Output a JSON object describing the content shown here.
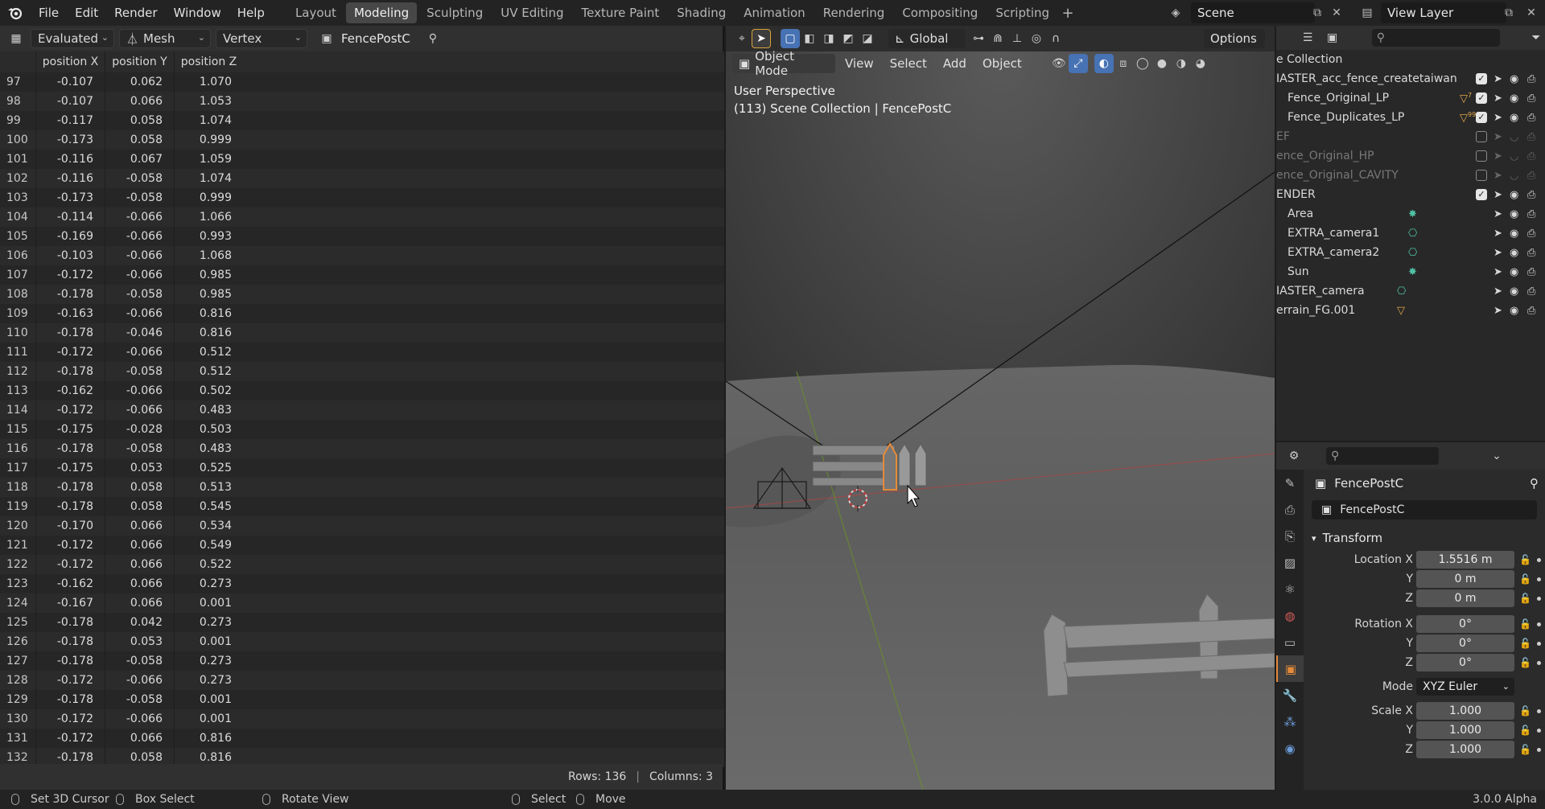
{
  "menu": [
    "File",
    "Edit",
    "Render",
    "Window",
    "Help"
  ],
  "workspaces": [
    "Layout",
    "Modeling",
    "Sculpting",
    "UV Editing",
    "Texture Paint",
    "Shading",
    "Animation",
    "Rendering",
    "Compositing",
    "Scripting"
  ],
  "active_workspace": "Modeling",
  "scene_name": "Scene",
  "view_layer_name": "View Layer",
  "spreadsheet": {
    "evaluation": "Evaluated",
    "geometry": "Mesh",
    "domain": "Vertex",
    "object": "FencePostC",
    "columns": [
      "position X",
      "position Y",
      "position Z"
    ],
    "rows": [
      [
        "97",
        "-0.107",
        "0.062",
        "1.070"
      ],
      [
        "98",
        "-0.107",
        "0.066",
        "1.053"
      ],
      [
        "99",
        "-0.117",
        "0.058",
        "1.074"
      ],
      [
        "100",
        "-0.173",
        "0.058",
        "0.999"
      ],
      [
        "101",
        "-0.116",
        "0.067",
        "1.059"
      ],
      [
        "102",
        "-0.116",
        "-0.058",
        "1.074"
      ],
      [
        "103",
        "-0.173",
        "-0.058",
        "0.999"
      ],
      [
        "104",
        "-0.114",
        "-0.066",
        "1.066"
      ],
      [
        "105",
        "-0.169",
        "-0.066",
        "0.993"
      ],
      [
        "106",
        "-0.103",
        "-0.066",
        "1.068"
      ],
      [
        "107",
        "-0.172",
        "-0.066",
        "0.985"
      ],
      [
        "108",
        "-0.178",
        "-0.058",
        "0.985"
      ],
      [
        "109",
        "-0.163",
        "-0.066",
        "0.816"
      ],
      [
        "110",
        "-0.178",
        "-0.046",
        "0.816"
      ],
      [
        "111",
        "-0.172",
        "-0.066",
        "0.512"
      ],
      [
        "112",
        "-0.178",
        "-0.058",
        "0.512"
      ],
      [
        "113",
        "-0.162",
        "-0.066",
        "0.502"
      ],
      [
        "114",
        "-0.172",
        "-0.066",
        "0.483"
      ],
      [
        "115",
        "-0.175",
        "-0.028",
        "0.503"
      ],
      [
        "116",
        "-0.178",
        "-0.058",
        "0.483"
      ],
      [
        "117",
        "-0.175",
        "0.053",
        "0.525"
      ],
      [
        "118",
        "-0.178",
        "0.058",
        "0.513"
      ],
      [
        "119",
        "-0.178",
        "0.058",
        "0.545"
      ],
      [
        "120",
        "-0.170",
        "0.066",
        "0.534"
      ],
      [
        "121",
        "-0.172",
        "0.066",
        "0.549"
      ],
      [
        "122",
        "-0.172",
        "0.066",
        "0.522"
      ],
      [
        "123",
        "-0.162",
        "0.066",
        "0.273"
      ],
      [
        "124",
        "-0.167",
        "0.066",
        "0.001"
      ],
      [
        "125",
        "-0.178",
        "0.042",
        "0.273"
      ],
      [
        "126",
        "-0.178",
        "0.053",
        "0.001"
      ],
      [
        "127",
        "-0.178",
        "-0.058",
        "0.273"
      ],
      [
        "128",
        "-0.172",
        "-0.066",
        "0.273"
      ],
      [
        "129",
        "-0.178",
        "-0.058",
        "0.001"
      ],
      [
        "130",
        "-0.172",
        "-0.066",
        "0.001"
      ],
      [
        "131",
        "-0.172",
        "0.066",
        "0.816"
      ],
      [
        "132",
        "-0.178",
        "0.058",
        "0.816"
      ]
    ],
    "rows_label": "Rows: 136",
    "columns_label": "Columns: 3"
  },
  "viewport": {
    "transform_orientation": "Global",
    "options_label": "Options",
    "mode": "Object Mode",
    "menus": [
      "View",
      "Select",
      "Add",
      "Object"
    ],
    "perspective": "User Perspective",
    "collection_info": "(113) Scene Collection | FencePostC"
  },
  "outliner": {
    "header": "e Collection",
    "items": [
      {
        "label": "IASTER_acc_fence_createtaiwan",
        "dim": false,
        "checkbox": true
      },
      {
        "label": "Fence_Original_LP",
        "dim": false,
        "checkbox": true,
        "badge": "7"
      },
      {
        "label": "Fence_Duplicates_LP",
        "dim": false,
        "checkbox": true,
        "badge": "99"
      },
      {
        "label": "EF",
        "dim": true,
        "checkbox": false
      },
      {
        "label": "ence_Original_HP",
        "dim": true,
        "checkbox": false
      },
      {
        "label": "ence_Original_CAVITY",
        "dim": true,
        "checkbox": false
      },
      {
        "label": "ENDER",
        "dim": false,
        "checkbox": true
      },
      {
        "label": "Area",
        "dim": false,
        "checkbox": null
      },
      {
        "label": "EXTRA_camera1",
        "dim": false,
        "checkbox": null
      },
      {
        "label": "EXTRA_camera2",
        "dim": false,
        "checkbox": null
      },
      {
        "label": "Sun",
        "dim": false,
        "checkbox": null
      },
      {
        "label": "IASTER_camera",
        "dim": false,
        "checkbox": null
      },
      {
        "label": "errain_FG.001",
        "dim": false,
        "checkbox": null
      }
    ]
  },
  "properties": {
    "object_name": "FencePostC",
    "data_name": "FencePostC",
    "panel": "Transform",
    "location": {
      "label": "Location X",
      "x": "1.5516 m",
      "y": "0 m",
      "z": "0 m"
    },
    "rotation": {
      "label": "Rotation X",
      "x": "0°",
      "y": "0°",
      "z": "0°"
    },
    "mode_label": "Mode",
    "mode_value": "XYZ Euler",
    "scale": {
      "label": "Scale X",
      "x": "1.000",
      "y": "1.000",
      "z": "1.000"
    },
    "axis_y": "Y",
    "axis_z": "Z"
  },
  "statusbar": {
    "items": [
      "Set 3D Cursor",
      "Box Select",
      "Rotate View",
      "Select",
      "Move"
    ],
    "version": "3.0.0 Alpha"
  },
  "colors": {
    "accent": "#4772b3",
    "active_object": "#e58a3a",
    "background": "#1d1d1d"
  }
}
